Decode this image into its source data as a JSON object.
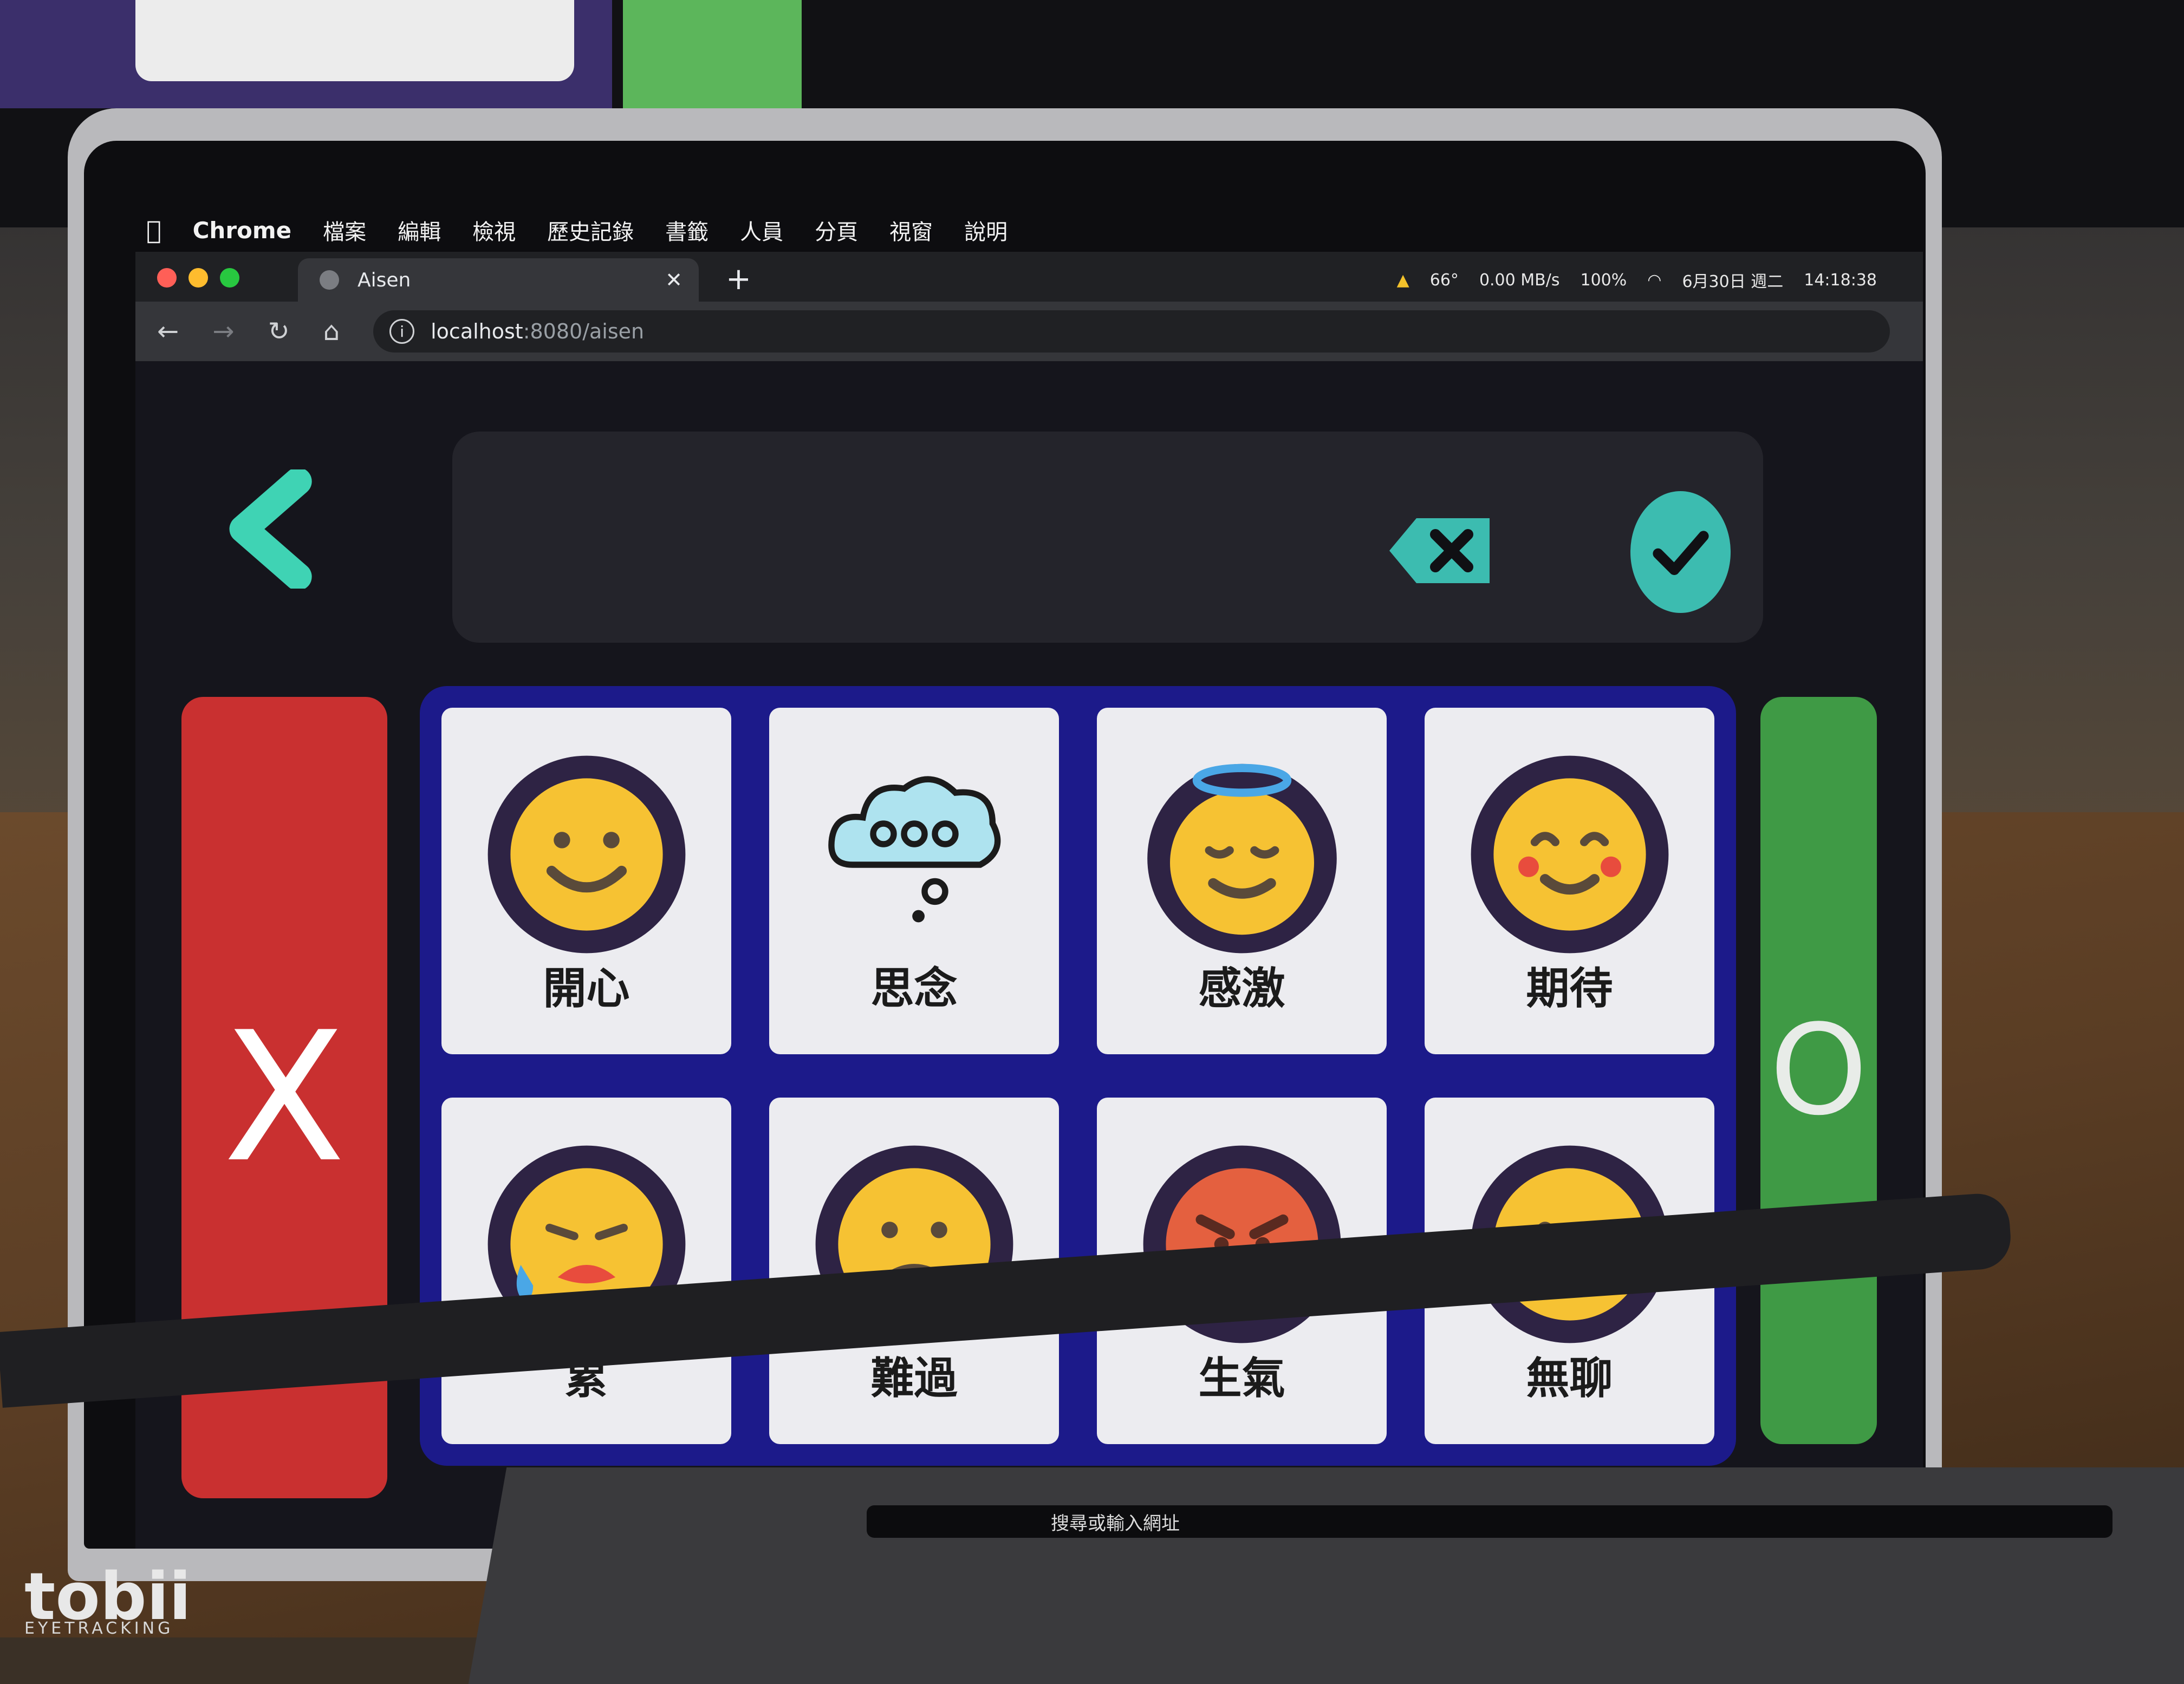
{
  "menubar": {
    "app": "Chrome",
    "items": [
      "檔案",
      "編輯",
      "檢視",
      "歷史記錄",
      "書籤",
      "人員",
      "分頁",
      "視窗",
      "說明"
    ]
  },
  "status": {
    "temperature": "66°",
    "network": "0.00 MB/s",
    "battery": "100%",
    "date": "6月30日 週二",
    "time": "14:18:38"
  },
  "browser": {
    "tab_title": "Aisen",
    "url_host": "localhost",
    "url_path": ":8080/aisen"
  },
  "app": {
    "no_label": "X",
    "yes_label": "O",
    "cards": [
      {
        "label": "開心",
        "icon": "happy-face-icon"
      },
      {
        "label": "思念",
        "icon": "thought-cloud-icon"
      },
      {
        "label": "感激",
        "icon": "angel-face-icon"
      },
      {
        "label": "期待",
        "icon": "blushing-face-icon"
      },
      {
        "label": "累",
        "icon": "tired-sweat-face-icon"
      },
      {
        "label": "難過",
        "icon": "sad-face-icon"
      },
      {
        "label": "生氣",
        "icon": "angry-face-icon"
      },
      {
        "label": "無聊",
        "icon": "neutral-face-icon"
      }
    ]
  },
  "device": {
    "brand": "tobii",
    "sub": "EYETRACKING",
    "touchbar_search": "搜尋或輸入網址"
  },
  "colors": {
    "no": "#c93030",
    "yes": "#3f9a45",
    "grid": "#1c1a8a",
    "accent": "#3cbcb0",
    "face": "#f6c233",
    "face_ring": "#2e2344"
  }
}
